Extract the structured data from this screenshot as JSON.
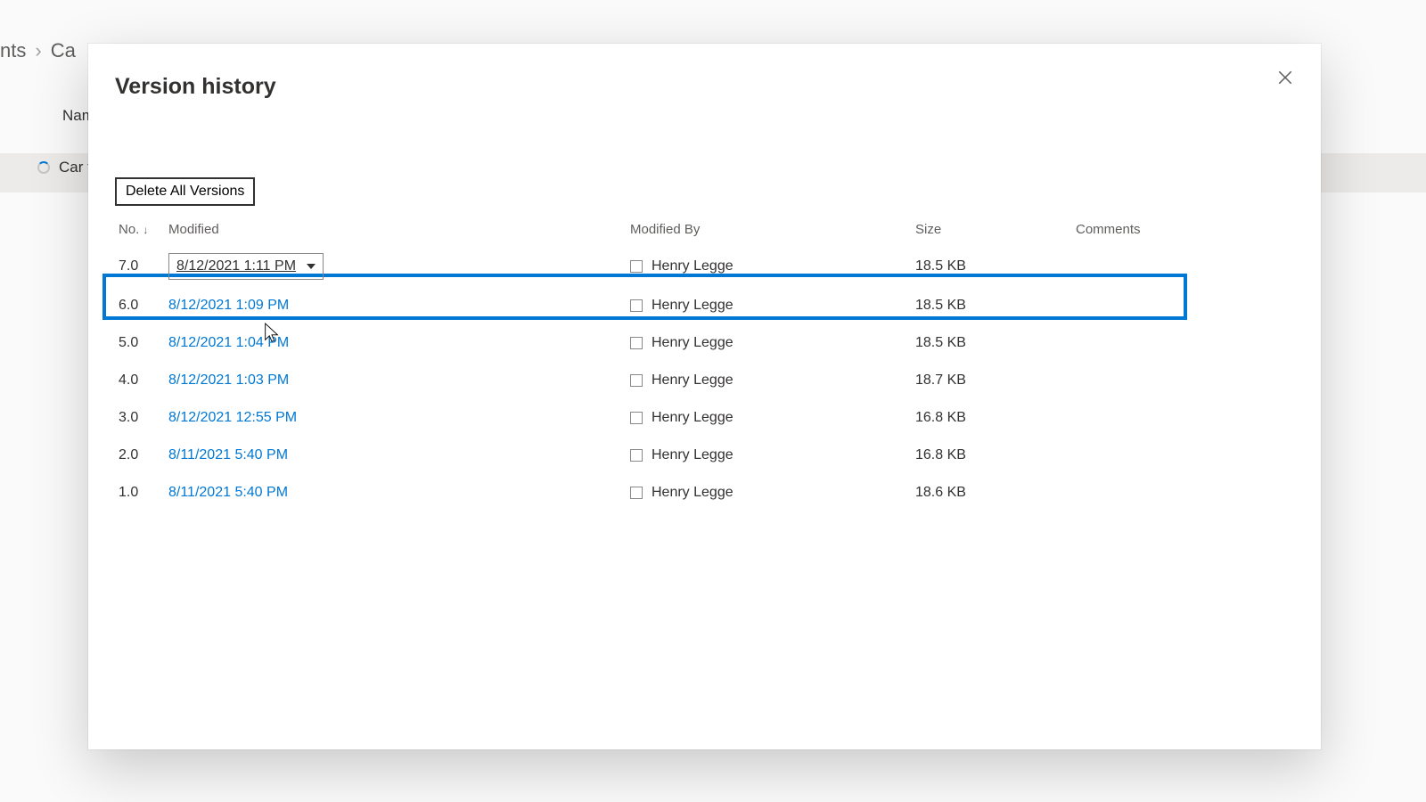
{
  "background": {
    "breadcrumb_prev": "nts",
    "breadcrumb_current": "Ca",
    "column_name": "Name",
    "selected_file": "Car typ"
  },
  "dialog": {
    "title": "Version history",
    "delete_all_label": "Delete All Versions",
    "columns": {
      "no": "No.",
      "modified": "Modified",
      "modified_by": "Modified By",
      "size": "Size",
      "comments": "Comments"
    },
    "rows": [
      {
        "no": "7.0",
        "modified": "8/12/2021 1:11 PM",
        "modified_by": "Henry Legge",
        "size": "18.5 KB",
        "highlighted": true,
        "has_dropdown": true
      },
      {
        "no": "6.0",
        "modified": "8/12/2021 1:09 PM",
        "modified_by": "Henry Legge",
        "size": "18.5 KB",
        "highlighted": false,
        "has_dropdown": false
      },
      {
        "no": "5.0",
        "modified": "8/12/2021 1:04 PM",
        "modified_by": "Henry Legge",
        "size": "18.5 KB",
        "highlighted": false,
        "has_dropdown": false
      },
      {
        "no": "4.0",
        "modified": "8/12/2021 1:03 PM",
        "modified_by": "Henry Legge",
        "size": "18.7 KB",
        "highlighted": false,
        "has_dropdown": false
      },
      {
        "no": "3.0",
        "modified": "8/12/2021 12:55 PM",
        "modified_by": "Henry Legge",
        "size": "16.8 KB",
        "highlighted": false,
        "has_dropdown": false
      },
      {
        "no": "2.0",
        "modified": "8/11/2021 5:40 PM",
        "modified_by": "Henry Legge",
        "size": "16.8 KB",
        "highlighted": false,
        "has_dropdown": false
      },
      {
        "no": "1.0",
        "modified": "8/11/2021 5:40 PM",
        "modified_by": "Henry Legge",
        "size": "18.6 KB",
        "highlighted": false,
        "has_dropdown": false
      }
    ]
  }
}
